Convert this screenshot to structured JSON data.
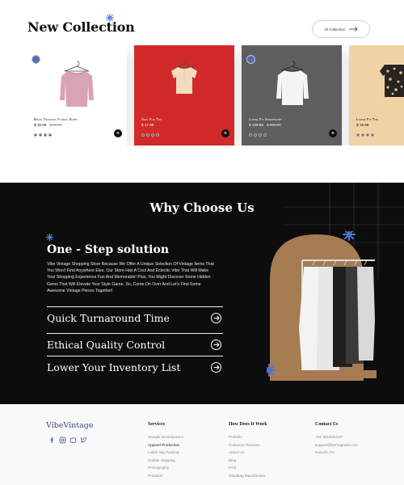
{
  "collection": {
    "title": "New Collection",
    "all_button": "All Collection",
    "products": [
      {
        "name": "Boho Tropical Floral Shirt",
        "price": "$ 15.99",
        "old_price": "$ 19.99",
        "bg": "#ffffff",
        "garment_color": "#d9a3b1",
        "badge": true
      },
      {
        "name": "Shih Fuh Top",
        "price": "$ 17.99",
        "old_price": "",
        "bg": "#d22a2a",
        "garment_color": "#f2dcc0",
        "badge": false
      },
      {
        "name": "Loose Fit Sweatshirt",
        "price": "$ 109.99",
        "old_price": "$ 399.99",
        "bg": "#5e5e5e",
        "garment_color": "#f4f4f4",
        "badge": true
      },
      {
        "name": "Loose Fit Top",
        "price": "$ 19.99",
        "old_price": "",
        "bg": "#efd3a4",
        "garment_color": "#2a2420",
        "badge": false
      }
    ]
  },
  "why": {
    "title": "Why Choose Us",
    "step_title": "One - Step solution",
    "step_desc": "Vibe Vintage Shopping Store Because We Offer A Unique Selection Of Vintage Items That You Won't Find Anywhere Else. Our Store Has A Cool And Eclectic Vibe That Will Make Your Shopping Experience Fun And Memorable! Plus, You Might Discover Some Hidden Gems That Will Elevate Your Style Game. So, Come On Over And Let's Find Some Awesome Vintage Pieces Together!",
    "features": [
      {
        "label": "Quick Turnaround Time"
      },
      {
        "label": "Ethical Quality Control"
      },
      {
        "label": "Lower Your Inventory List"
      }
    ]
  },
  "footer": {
    "brand": "VibeVintage",
    "socials": [
      "facebook-icon",
      "instagram-icon",
      "discord-icon",
      "twitter-icon"
    ],
    "services": {
      "heading": "Services",
      "items": [
        "Sample Development",
        "Apparel Production",
        "Liable Tag Packing",
        "Dobbie Shipping",
        "Photography",
        "Products"
      ]
    },
    "how": {
      "heading": "How Does It Work",
      "items": [
        "Portfolio",
        "Customer Reviews",
        "About Us",
        "Blog",
        "FAQ",
        "Handbag Manufacture"
      ]
    },
    "contact": {
      "heading": "Contact Us",
      "items": [
        "+92 3042044447",
        "support@farmagmail.com",
        "Karachi, PK"
      ]
    }
  }
}
